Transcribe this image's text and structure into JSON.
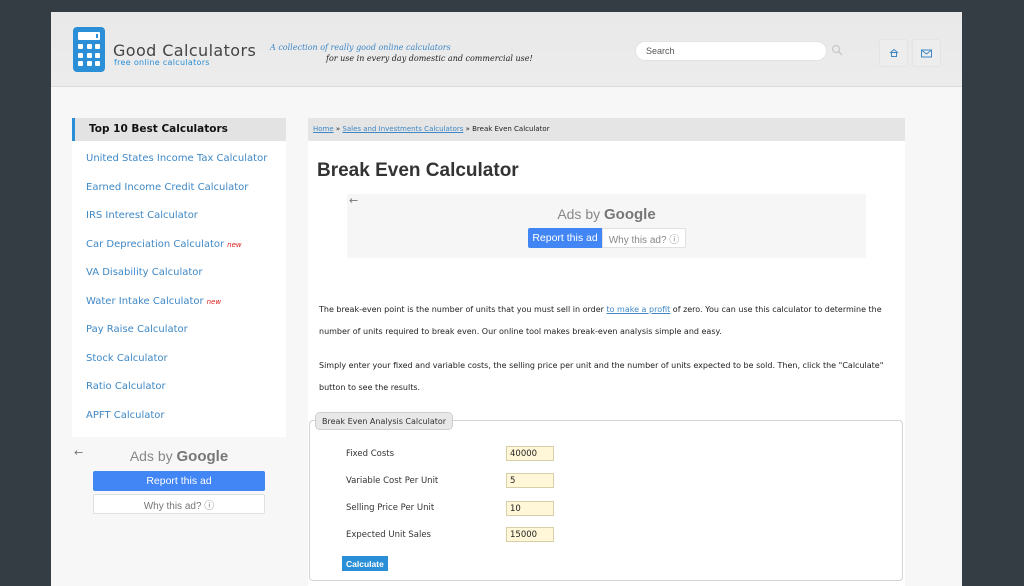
{
  "header": {
    "logo_title": "Good Calculators",
    "logo_subtitle": "free online calculators",
    "tagline_line1": "A collection of really good online calculators",
    "tagline_line2": "for use in every day domestic and commercial use!",
    "search_placeholder": "Search",
    "home_icon": "home-icon",
    "email_icon": "envelope-icon",
    "brand_color": "#2a8fd6"
  },
  "sidebar": {
    "title": "Top 10 Best Calculators",
    "items": [
      {
        "label": "United States Income Tax Calculator",
        "badge": ""
      },
      {
        "label": "Earned Income Credit Calculator",
        "badge": ""
      },
      {
        "label": "IRS Interest Calculator",
        "badge": ""
      },
      {
        "label": "Car Depreciation Calculator",
        "badge": "new"
      },
      {
        "label": "VA Disability Calculator",
        "badge": ""
      },
      {
        "label": "Water Intake Calculator",
        "badge": "new"
      },
      {
        "label": "Pay Raise Calculator",
        "badge": ""
      },
      {
        "label": "Stock Calculator",
        "badge": ""
      },
      {
        "label": "Ratio Calculator",
        "badge": ""
      },
      {
        "label": "APFT Calculator",
        "badge": ""
      }
    ],
    "ad": {
      "back_arrow": "←",
      "ads_by": "Ads by",
      "google": "Google",
      "report": "Report this ad",
      "why": "Why this ad? ⓘ"
    }
  },
  "main": {
    "breadcrumb": {
      "home": "Home",
      "sep": " » ",
      "category": "Sales and Investments Calculators",
      "current": "Break Even Calculator"
    },
    "title": "Break Even Calculator",
    "ad": {
      "back_arrow": "←",
      "ads_by": "Ads by",
      "google": "Google",
      "report": "Report this ad",
      "why": "Why this ad? ⓘ"
    },
    "para1_before": "The break-even point is the number of units that you must sell in order ",
    "para1_link": "to make a profit",
    "para1_after": " of zero. You can use this calculator to determine the number of units required to break even. Our online tool makes break-even analysis simple and easy.",
    "para2": "Simply enter your fixed and variable costs, the selling price per unit and the number of units expected to be sold. Then, click the \"Calculate\" button to see the results.",
    "calculator": {
      "legend": "Break Even Analysis Calculator",
      "fields": [
        {
          "label": "Fixed Costs",
          "value": "40000"
        },
        {
          "label": "Variable Cost Per Unit",
          "value": "5"
        },
        {
          "label": "Selling Price Per Unit",
          "value": "10"
        },
        {
          "label": "Expected Unit Sales",
          "value": "15000"
        }
      ],
      "button": "Calculate"
    }
  }
}
